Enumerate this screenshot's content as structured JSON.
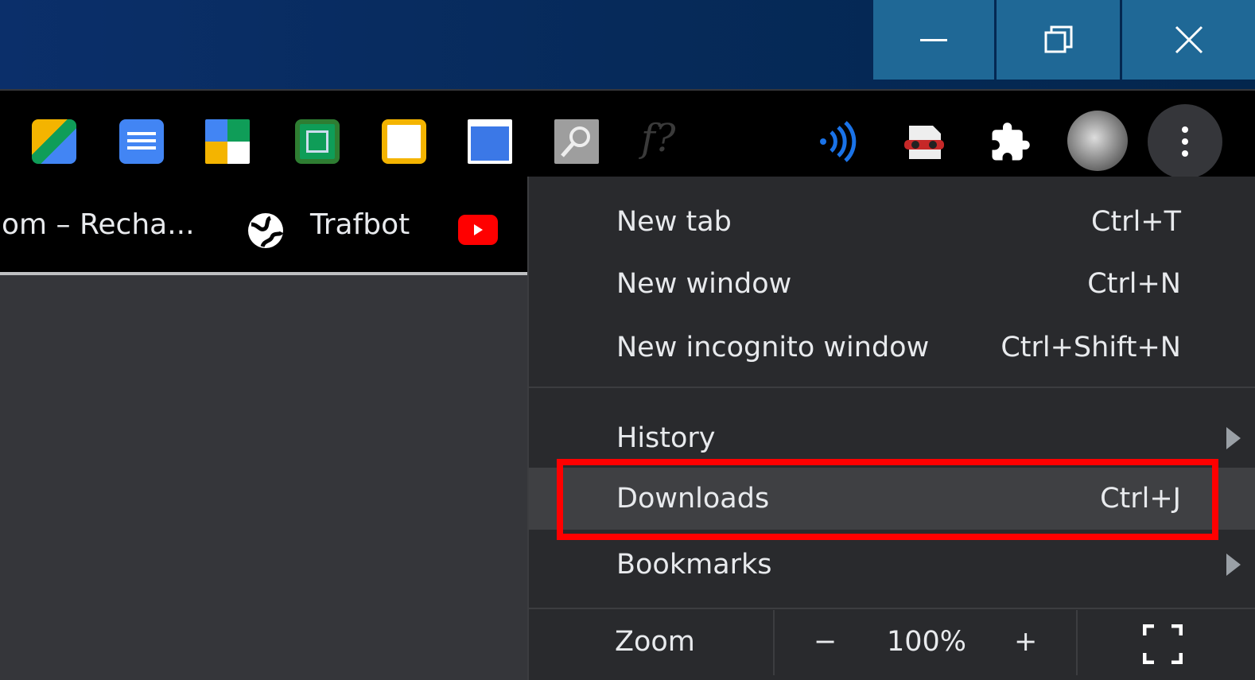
{
  "window_controls": {
    "minimize": "minimize-icon",
    "restore": "restore-icon",
    "close": "close-icon"
  },
  "extensions": [
    "google-drive-icon",
    "google-docs-icon",
    "google-sites-icon",
    "google-sheets-icon",
    "google-slides-icon",
    "screen-capture-icon",
    "search-extension-icon",
    "formula-icon",
    "wifi-signal-icon",
    "incognito-icon",
    "puzzle-icon"
  ],
  "bookmarks": [
    {
      "label": "om – Recha..."
    },
    {
      "label": "Trafbot"
    }
  ],
  "menu": {
    "items": [
      {
        "label": "New tab",
        "shortcut": "Ctrl+T"
      },
      {
        "label": "New window",
        "shortcut": "Ctrl+N"
      },
      {
        "label": "New incognito window",
        "shortcut": "Ctrl+Shift+N"
      },
      {
        "label": "History"
      },
      {
        "label": "Downloads",
        "shortcut": "Ctrl+J"
      },
      {
        "label": "Bookmarks"
      }
    ],
    "zoom": {
      "label": "Zoom",
      "minus": "−",
      "value": "100%",
      "plus": "+"
    }
  },
  "colors": {
    "highlight": "#ff0000",
    "menu_bg": "#292a2d"
  }
}
